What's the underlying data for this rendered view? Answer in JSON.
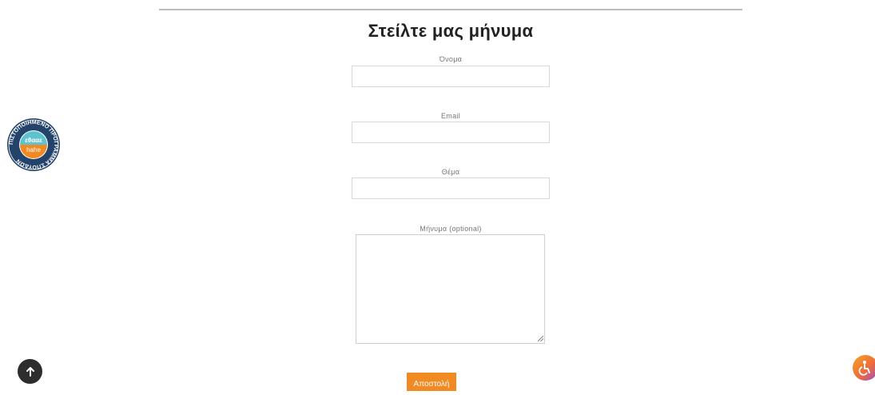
{
  "form": {
    "title": "Στείλτε μας μήνυμα",
    "fields": [
      {
        "label": "Όνομα",
        "value": "",
        "placeholder": ""
      },
      {
        "label": "Email",
        "value": "",
        "placeholder": ""
      },
      {
        "label": "Θέμα",
        "value": "",
        "placeholder": ""
      }
    ],
    "message": {
      "label": "Μήνυμα (optional)",
      "value": "",
      "placeholder": ""
    },
    "submit_label": "Αποστολή"
  },
  "badge": {
    "ring_text": "ΠΙΣΤΟΠΟΙΗΜΕΝΟ ΠΡΟΓΡΑΜΜΑ ΣΠΟΥΔΩΝ",
    "top_text": "εθααε",
    "bottom_text": "hahe"
  },
  "icons": {
    "scroll_top": "arrow-up-icon",
    "accessibility": "accessibility-icon"
  },
  "colors": {
    "accent": "#f28a24",
    "badge_teal": "#5fc2cf",
    "badge_orange": "#f28a24"
  }
}
